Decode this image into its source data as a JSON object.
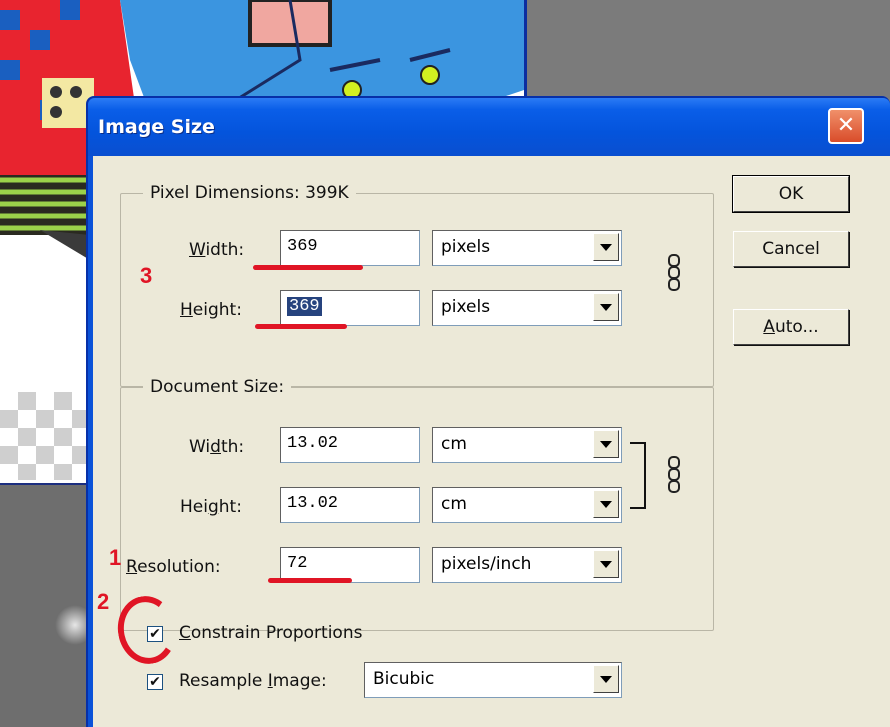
{
  "dialog": {
    "title": "Image Size",
    "close_label": "✕"
  },
  "pixel_dimensions": {
    "heading": "Pixel Dimensions:  399K",
    "width_label": "Width:",
    "width_value": "369",
    "width_unit": "pixels",
    "height_label": "Height:",
    "height_value": "369",
    "height_unit": "pixels"
  },
  "document_size": {
    "heading": "Document Size:",
    "width_label": "Width:",
    "width_value": "13.02",
    "width_unit": "cm",
    "height_label": "Height:",
    "height_value": "13.02",
    "height_unit": "cm",
    "resolution_label": "Resolution:",
    "resolution_value": "72",
    "resolution_unit": "pixels/inch"
  },
  "options": {
    "constrain_label": "Constrain Proportions",
    "constrain_checked": true,
    "resample_label": "Resample Image:",
    "resample_checked": true,
    "resample_method": "Bicubic"
  },
  "buttons": {
    "ok": "OK",
    "cancel": "Cancel",
    "auto": "Auto..."
  },
  "annotations": {
    "n1": "1",
    "n2": "2",
    "n3": "3"
  },
  "colors": {
    "title_bar": "#0a5ee8",
    "dialog_body": "#ece9d8",
    "annotation_red": "#e01525",
    "selection": "#26437e"
  }
}
